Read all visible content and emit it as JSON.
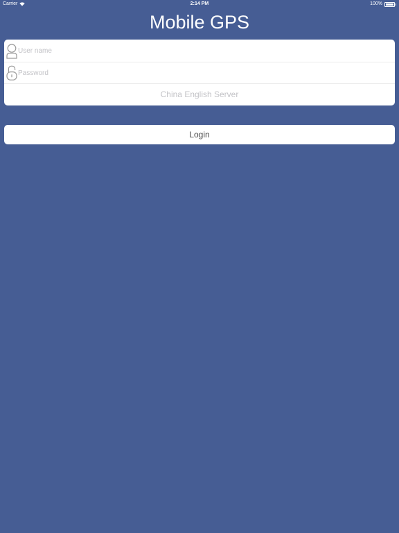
{
  "status_bar": {
    "carrier": "Carrier",
    "time": "2:14 PM",
    "battery": "100%",
    "battery_level": 1.0
  },
  "app": {
    "title": "Mobile GPS"
  },
  "login_form": {
    "username": {
      "placeholder": "User name",
      "value": "",
      "icon": "user-icon"
    },
    "password": {
      "placeholder": "Password",
      "value": "",
      "icon": "lock-icon"
    },
    "server": {
      "label": "China English Server"
    }
  },
  "actions": {
    "login_label": "Login"
  },
  "colors": {
    "background": "#465d94",
    "card": "#ffffff",
    "placeholder": "#c2c2c6",
    "button_text": "#4a4a4a"
  }
}
